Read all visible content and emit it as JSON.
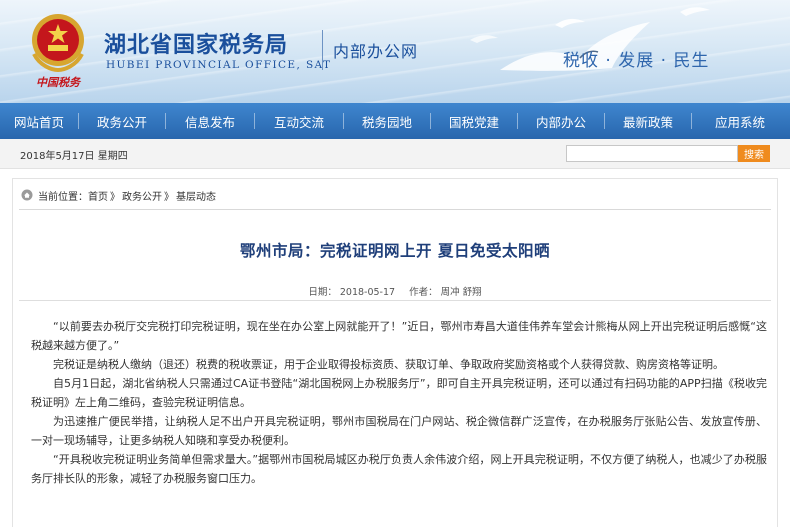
{
  "header": {
    "emblem_caption": "中国税务",
    "site_title": "湖北省国家税务局",
    "site_subtitle": "HUBEI PROVINCIAL OFFICE, SAT",
    "intranet_label": "内部办公网",
    "slogan": "税收 · 发展 · 民生"
  },
  "nav": {
    "items": [
      {
        "label": "网站首页"
      },
      {
        "label": "政务公开"
      },
      {
        "label": "信息发布"
      },
      {
        "label": "互动交流"
      },
      {
        "label": "税务园地"
      },
      {
        "label": "国税党建"
      },
      {
        "label": "内部办公"
      },
      {
        "label": "最新政策"
      },
      {
        "label": "应用系统"
      }
    ]
  },
  "infobar": {
    "date": "2018年5月17日",
    "weekday": "星期四",
    "search_placeholder": "",
    "search_label": "搜索"
  },
  "breadcrumb": {
    "prefix": "当前位置：",
    "items": [
      "首页",
      "政务公开",
      "基层动态"
    ],
    "separator": "》"
  },
  "article": {
    "title": "鄂州市局：完税证明网上开  夏日免受太阳晒",
    "date_label": "日期：",
    "date": "2018-05-17",
    "author_label": "作者：",
    "author": "周冲 舒翔",
    "paragraphs": [
      "“以前要去办税厅交完税打印完税证明，现在坐在办公室上网就能开了！”近日，鄂州市寿昌大道佳伟养车堂会计熊梅从网上开出完税证明后感慨“这税越来越方便了。”",
      "完税证是纳税人缴纳（退还）税费的税收票证，用于企业取得投标资质、获取订单、争取政府奖励资格或个人获得贷款、购房资格等证明。",
      "自5月1日起，湖北省纳税人只需通过CA证书登陆“湖北国税网上办税服务厅”，即可自主开具完税证明，还可以通过有扫码功能的APP扫描《税收完税证明》左上角二维码，查验完税证明信息。",
      "为迅速推广便民举措，让纳税人足不出户开具完税证明，鄂州市国税局在门户网站、税企微信群广泛宣传，在办税服务厅张贴公告、发放宣传册、一对一现场辅导，让更多纳税人知晓和享受办税便利。",
      "“开具税收完税证明业务简单但需求量大。”据鄂州市国税局城区办税厅负责人余伟波介绍，网上开具完税证明，不仅方便了纳税人，也减少了办税服务厅排长队的形象，减轻了办税服务窗口压力。"
    ]
  },
  "colors": {
    "nav_bg": "#2f72bd",
    "brand_blue": "#1a4f9c",
    "title_blue": "#1f3f7a",
    "search_orange": "#ef8b1e",
    "emblem_red": "#c4161c"
  }
}
